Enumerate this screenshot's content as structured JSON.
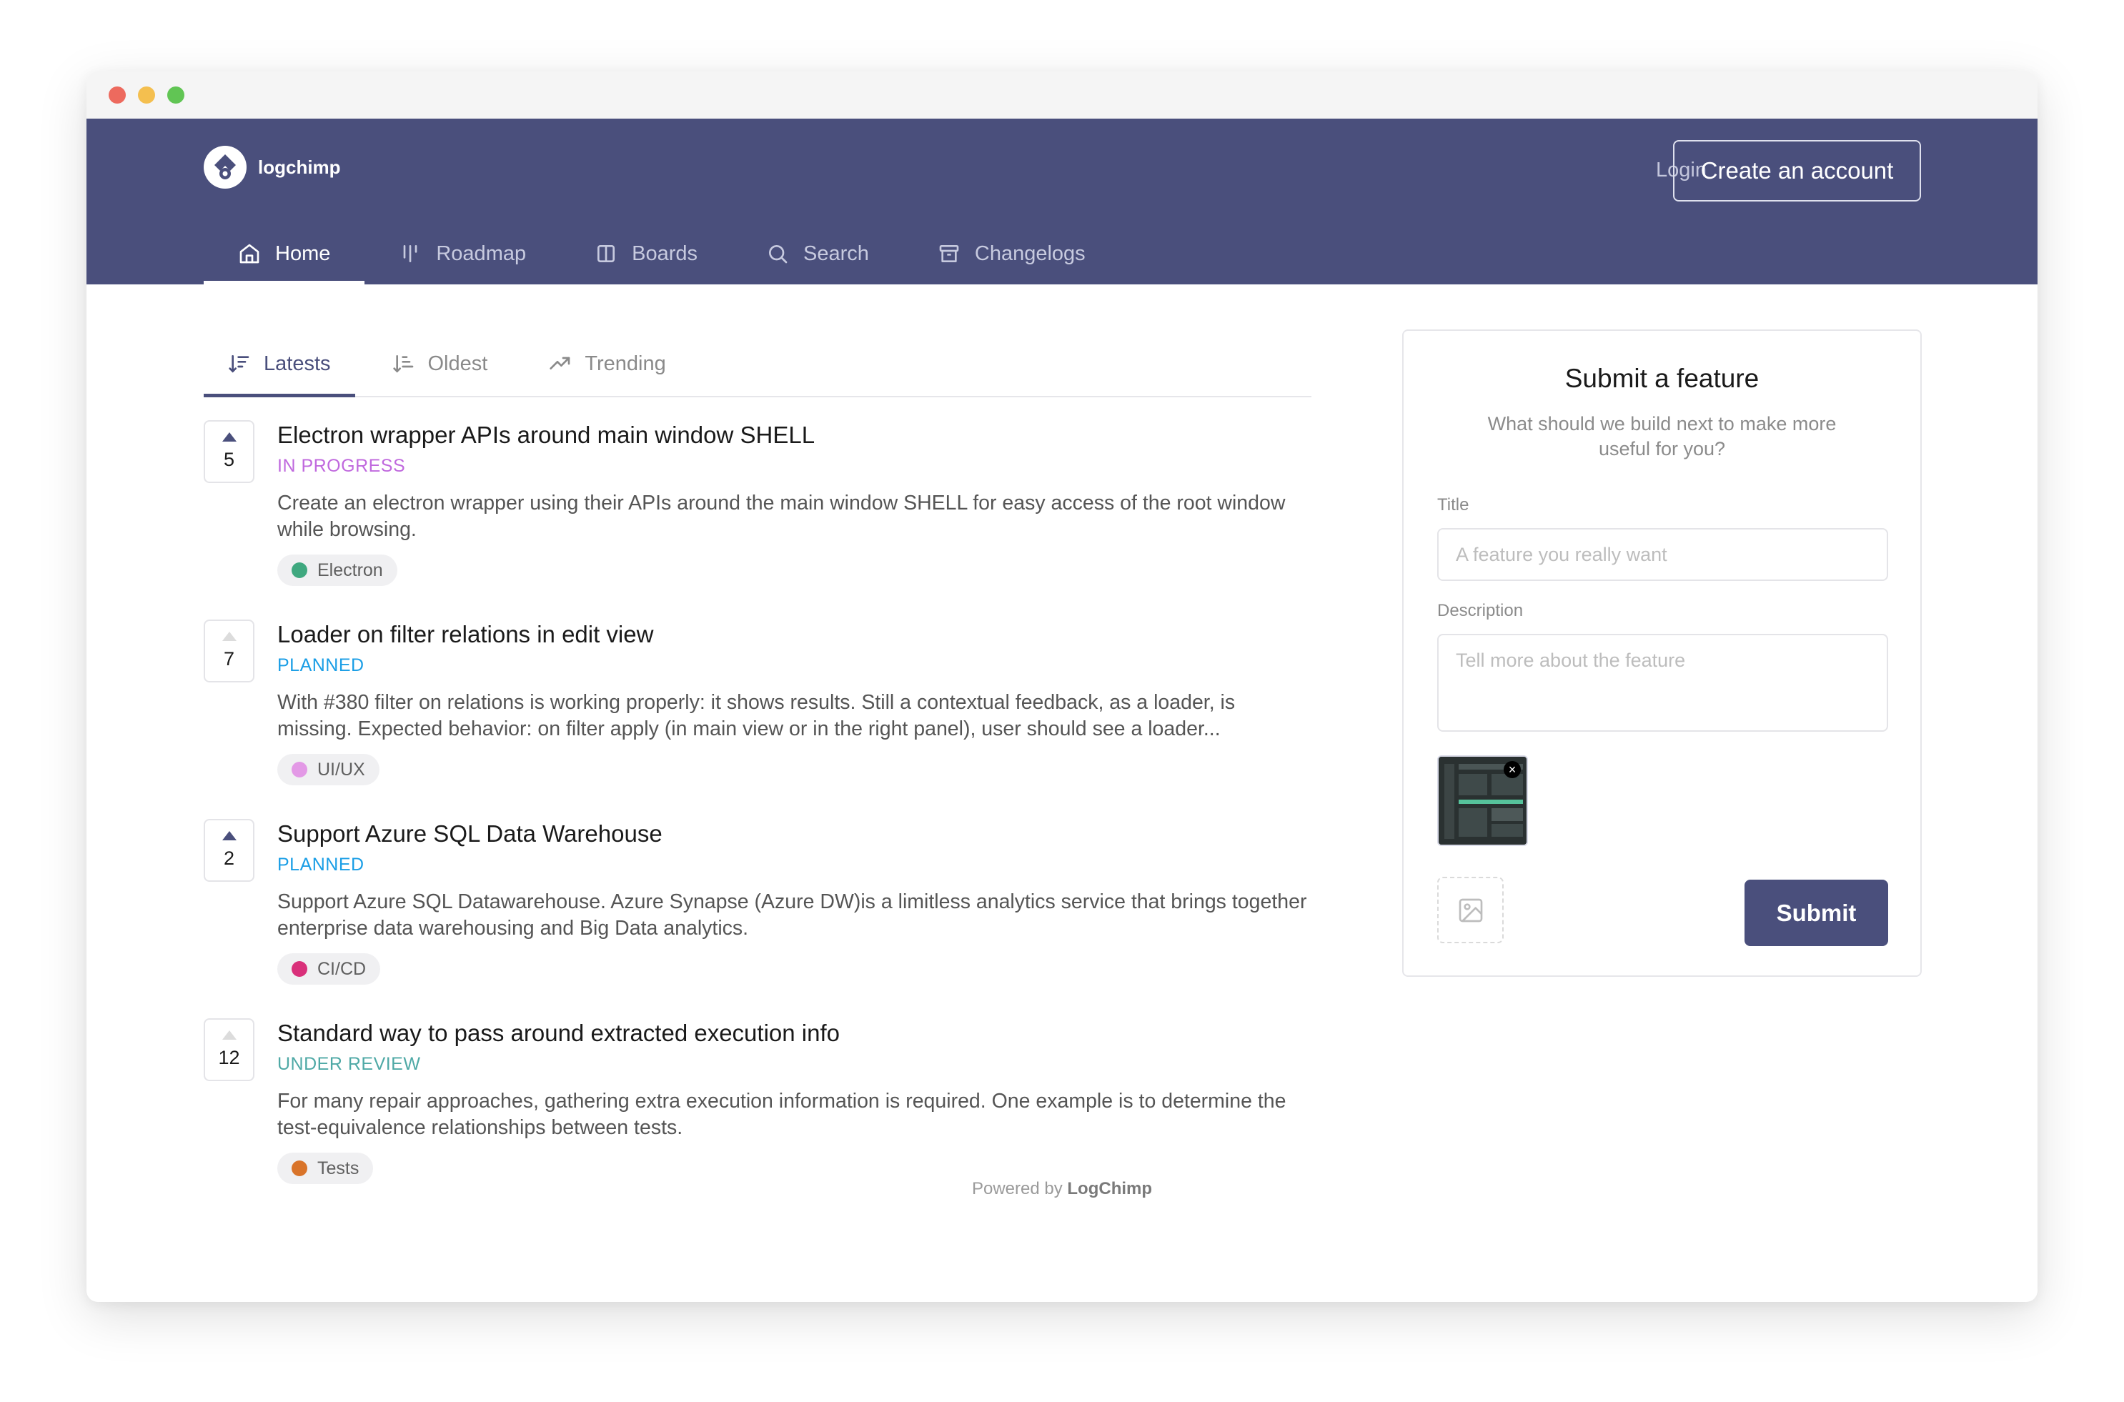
{
  "brand": {
    "name": "logchimp"
  },
  "header": {
    "login_label": "Login",
    "create_account_label": "Create an account"
  },
  "nav": [
    {
      "label": "Home",
      "icon": "home-icon",
      "active": true
    },
    {
      "label": "Roadmap",
      "icon": "roadmap-icon",
      "active": false
    },
    {
      "label": "Boards",
      "icon": "boards-icon",
      "active": false
    },
    {
      "label": "Search",
      "icon": "search-icon",
      "active": false
    },
    {
      "label": "Changelogs",
      "icon": "archive-icon",
      "active": false
    }
  ],
  "sort_tabs": [
    {
      "label": "Latests",
      "icon": "sort-descending-icon",
      "active": true
    },
    {
      "label": "Oldest",
      "icon": "sort-ascending-icon",
      "active": false
    },
    {
      "label": "Trending",
      "icon": "trending-up-icon",
      "active": false
    }
  ],
  "posts": [
    {
      "votes": "5",
      "voted": true,
      "title": "Electron wrapper APIs around main window SHELL",
      "status": "IN PROGRESS",
      "status_color": "#c069de",
      "description": "Create an electron wrapper using their APIs around the main window SHELL for easy access of the root window while browsing.",
      "tag": "Electron",
      "tag_color": "#3fa87f"
    },
    {
      "votes": "7",
      "voted": false,
      "title": "Loader on filter relations in edit view",
      "status": "PLANNED",
      "status_color": "#1a9ee6",
      "description": "With #380 filter on relations is working properly: it shows results. Still a contextual feedback, as a loader, is missing. Expected behavior: on filter apply (in main view or in the right panel), user should see a loader...",
      "tag": "UI/UX",
      "tag_color": "#e399e6"
    },
    {
      "votes": "2",
      "voted": true,
      "title": "Support Azure SQL Data Warehouse",
      "status": "PLANNED",
      "status_color": "#1a9ee6",
      "description": "Support Azure SQL Datawarehouse. Azure Synapse (Azure DW)is a limitless analytics service that brings together enterprise data warehousing and Big Data analytics.",
      "tag": "CI/CD",
      "tag_color": "#d9307a"
    },
    {
      "votes": "12",
      "voted": false,
      "title": "Standard way to pass around extracted execution info",
      "status": "UNDER REVIEW",
      "status_color": "#4fa9a6",
      "description": "For many repair approaches, gathering extra execution information is required. One example is to determine the test-equivalence relationships between tests.",
      "tag": "Tests",
      "tag_color": "#d9742a"
    }
  ],
  "footer": {
    "prefix": "Powered by",
    "brand": "LogChimp"
  },
  "submit_panel": {
    "title": "Submit a feature",
    "subtitle": "What should we build next to make more useful for you?",
    "title_label": "Title",
    "title_placeholder": "A feature you really want",
    "description_label": "Description",
    "description_placeholder": "Tell more about the feature",
    "submit_label": "Submit"
  },
  "colors": {
    "primary": "#4a4f7c",
    "header_bg": "#4a4f7c"
  }
}
